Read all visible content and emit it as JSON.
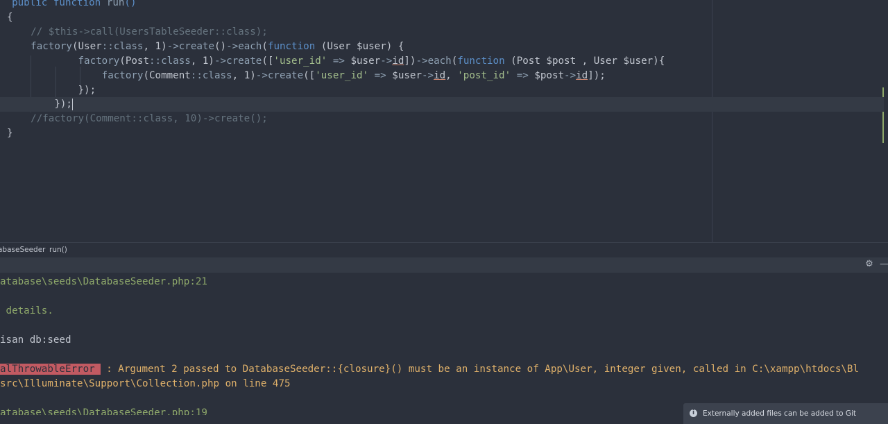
{
  "editor": {
    "lines": [
      "public function run()",
      "{",
      "    // $this->call(UsersTableSeeder::class);",
      "    factory(User::class, 1)->create()->each(function (User $user) {",
      "            factory(Post::class, 1)->create(['user_id' => $user->id])->each(function (Post $post , User $user){",
      "                factory(Comment::class, 1)->create(['user_id' => $user->id, 'post_id' => $post->id]);",
      "            });",
      "        });",
      "    //factory(Comment::class, 10)->create();",
      "}"
    ]
  },
  "breadcrumb": {
    "items": [
      "abaseSeeder",
      "run()"
    ]
  },
  "terminal": {
    "gear_icon": "gear-icon",
    "minimize_icon": "minimize-icon",
    "lines": {
      "l1": "atabase\\seeds\\DatabaseSeeder.php:21",
      "l2": " details.",
      "l3": "isan db:seed",
      "l4_badge": "alThrowableError",
      "l4_text": " : Argument 2 passed to DatabaseSeeder::{closure}() must be an instance of App\\User, integer given, called in C:\\xampp\\htdocs\\Bl",
      "l5": "src\\Illuminate\\Support\\Collection.php on line 475",
      "l6": "atabase\\seeds\\DatabaseSeeder.php:19"
    }
  },
  "toast": {
    "text": "Externally added files can be added to Git"
  },
  "colors": {
    "background": "#2b303b",
    "keyword": "#5c8fc8",
    "string": "#a3be8c",
    "comment": "#65737e",
    "error_badge": "#c25a62",
    "error_text": "#e0b16a"
  }
}
